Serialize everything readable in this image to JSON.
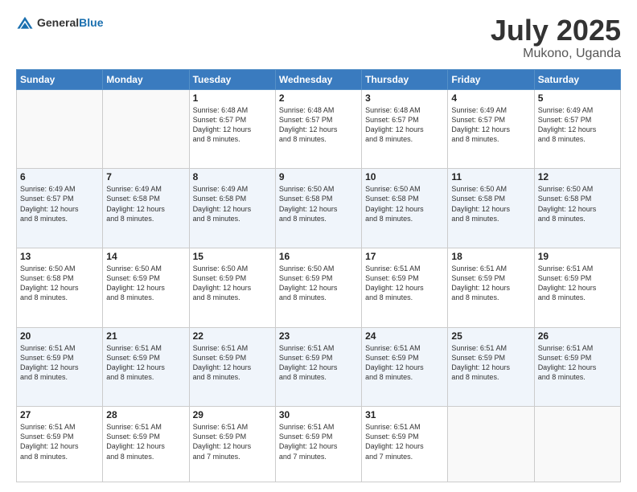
{
  "logo": {
    "general": "General",
    "blue": "Blue"
  },
  "header": {
    "title": "July 2025",
    "location": "Mukono, Uganda"
  },
  "weekdays": [
    "Sunday",
    "Monday",
    "Tuesday",
    "Wednesday",
    "Thursday",
    "Friday",
    "Saturday"
  ],
  "weeks": [
    [
      {
        "day": "",
        "info": ""
      },
      {
        "day": "",
        "info": ""
      },
      {
        "day": "1",
        "info": "Sunrise: 6:48 AM\nSunset: 6:57 PM\nDaylight: 12 hours\nand 8 minutes."
      },
      {
        "day": "2",
        "info": "Sunrise: 6:48 AM\nSunset: 6:57 PM\nDaylight: 12 hours\nand 8 minutes."
      },
      {
        "day": "3",
        "info": "Sunrise: 6:48 AM\nSunset: 6:57 PM\nDaylight: 12 hours\nand 8 minutes."
      },
      {
        "day": "4",
        "info": "Sunrise: 6:49 AM\nSunset: 6:57 PM\nDaylight: 12 hours\nand 8 minutes."
      },
      {
        "day": "5",
        "info": "Sunrise: 6:49 AM\nSunset: 6:57 PM\nDaylight: 12 hours\nand 8 minutes."
      }
    ],
    [
      {
        "day": "6",
        "info": "Sunrise: 6:49 AM\nSunset: 6:57 PM\nDaylight: 12 hours\nand 8 minutes."
      },
      {
        "day": "7",
        "info": "Sunrise: 6:49 AM\nSunset: 6:58 PM\nDaylight: 12 hours\nand 8 minutes."
      },
      {
        "day": "8",
        "info": "Sunrise: 6:49 AM\nSunset: 6:58 PM\nDaylight: 12 hours\nand 8 minutes."
      },
      {
        "day": "9",
        "info": "Sunrise: 6:50 AM\nSunset: 6:58 PM\nDaylight: 12 hours\nand 8 minutes."
      },
      {
        "day": "10",
        "info": "Sunrise: 6:50 AM\nSunset: 6:58 PM\nDaylight: 12 hours\nand 8 minutes."
      },
      {
        "day": "11",
        "info": "Sunrise: 6:50 AM\nSunset: 6:58 PM\nDaylight: 12 hours\nand 8 minutes."
      },
      {
        "day": "12",
        "info": "Sunrise: 6:50 AM\nSunset: 6:58 PM\nDaylight: 12 hours\nand 8 minutes."
      }
    ],
    [
      {
        "day": "13",
        "info": "Sunrise: 6:50 AM\nSunset: 6:58 PM\nDaylight: 12 hours\nand 8 minutes."
      },
      {
        "day": "14",
        "info": "Sunrise: 6:50 AM\nSunset: 6:59 PM\nDaylight: 12 hours\nand 8 minutes."
      },
      {
        "day": "15",
        "info": "Sunrise: 6:50 AM\nSunset: 6:59 PM\nDaylight: 12 hours\nand 8 minutes."
      },
      {
        "day": "16",
        "info": "Sunrise: 6:50 AM\nSunset: 6:59 PM\nDaylight: 12 hours\nand 8 minutes."
      },
      {
        "day": "17",
        "info": "Sunrise: 6:51 AM\nSunset: 6:59 PM\nDaylight: 12 hours\nand 8 minutes."
      },
      {
        "day": "18",
        "info": "Sunrise: 6:51 AM\nSunset: 6:59 PM\nDaylight: 12 hours\nand 8 minutes."
      },
      {
        "day": "19",
        "info": "Sunrise: 6:51 AM\nSunset: 6:59 PM\nDaylight: 12 hours\nand 8 minutes."
      }
    ],
    [
      {
        "day": "20",
        "info": "Sunrise: 6:51 AM\nSunset: 6:59 PM\nDaylight: 12 hours\nand 8 minutes."
      },
      {
        "day": "21",
        "info": "Sunrise: 6:51 AM\nSunset: 6:59 PM\nDaylight: 12 hours\nand 8 minutes."
      },
      {
        "day": "22",
        "info": "Sunrise: 6:51 AM\nSunset: 6:59 PM\nDaylight: 12 hours\nand 8 minutes."
      },
      {
        "day": "23",
        "info": "Sunrise: 6:51 AM\nSunset: 6:59 PM\nDaylight: 12 hours\nand 8 minutes."
      },
      {
        "day": "24",
        "info": "Sunrise: 6:51 AM\nSunset: 6:59 PM\nDaylight: 12 hours\nand 8 minutes."
      },
      {
        "day": "25",
        "info": "Sunrise: 6:51 AM\nSunset: 6:59 PM\nDaylight: 12 hours\nand 8 minutes."
      },
      {
        "day": "26",
        "info": "Sunrise: 6:51 AM\nSunset: 6:59 PM\nDaylight: 12 hours\nand 8 minutes."
      }
    ],
    [
      {
        "day": "27",
        "info": "Sunrise: 6:51 AM\nSunset: 6:59 PM\nDaylight: 12 hours\nand 8 minutes."
      },
      {
        "day": "28",
        "info": "Sunrise: 6:51 AM\nSunset: 6:59 PM\nDaylight: 12 hours\nand 8 minutes."
      },
      {
        "day": "29",
        "info": "Sunrise: 6:51 AM\nSunset: 6:59 PM\nDaylight: 12 hours\nand 7 minutes."
      },
      {
        "day": "30",
        "info": "Sunrise: 6:51 AM\nSunset: 6:59 PM\nDaylight: 12 hours\nand 7 minutes."
      },
      {
        "day": "31",
        "info": "Sunrise: 6:51 AM\nSunset: 6:59 PM\nDaylight: 12 hours\nand 7 minutes."
      },
      {
        "day": "",
        "info": ""
      },
      {
        "day": "",
        "info": ""
      }
    ]
  ]
}
